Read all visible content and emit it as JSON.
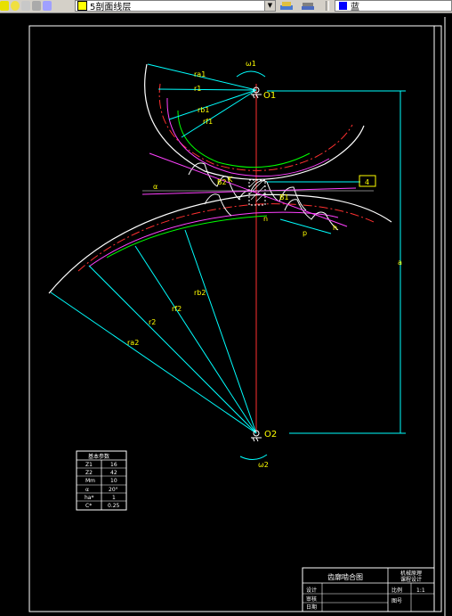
{
  "toolbar": {
    "layer_name": "5剖面线层",
    "color_name": "蓝",
    "colors": {
      "layer_swatch": "#ffff00",
      "color_swatch": "#0000ff"
    }
  },
  "drawing": {
    "title": "齿廓啮合图",
    "labels": {
      "omega1": "ω1",
      "omega2": "ω2",
      "o1": "O1",
      "o2": "O2",
      "ra1": "ra1",
      "r1": "r1",
      "rb1": "rb1",
      "rf1": "rf1",
      "rb2": "rb2",
      "r2": "r2",
      "rf2": "rf2",
      "ra2": "ra2",
      "alpha": "α",
      "a": "a",
      "n": "n",
      "h": "h",
      "p": "p",
      "b1": "B1",
      "b2": "B2",
      "k": "K",
      "box4": "4"
    },
    "param_table": {
      "title": "基本参数",
      "rows": [
        [
          "Z1",
          "16"
        ],
        [
          "Z2",
          "42"
        ],
        [
          "Mm",
          "10"
        ],
        [
          "α",
          "20°"
        ],
        [
          "ha*",
          "1"
        ],
        [
          "C*",
          "0.25"
        ]
      ]
    },
    "title_block": {
      "name": "齿廓啮合图",
      "school": "机械原理",
      "dept": "课程设计",
      "left_labels": [
        "设计",
        "审核",
        "日期"
      ],
      "right_labels": [
        "比例",
        "图号"
      ],
      "right_values": [
        "1:1",
        ""
      ]
    }
  }
}
